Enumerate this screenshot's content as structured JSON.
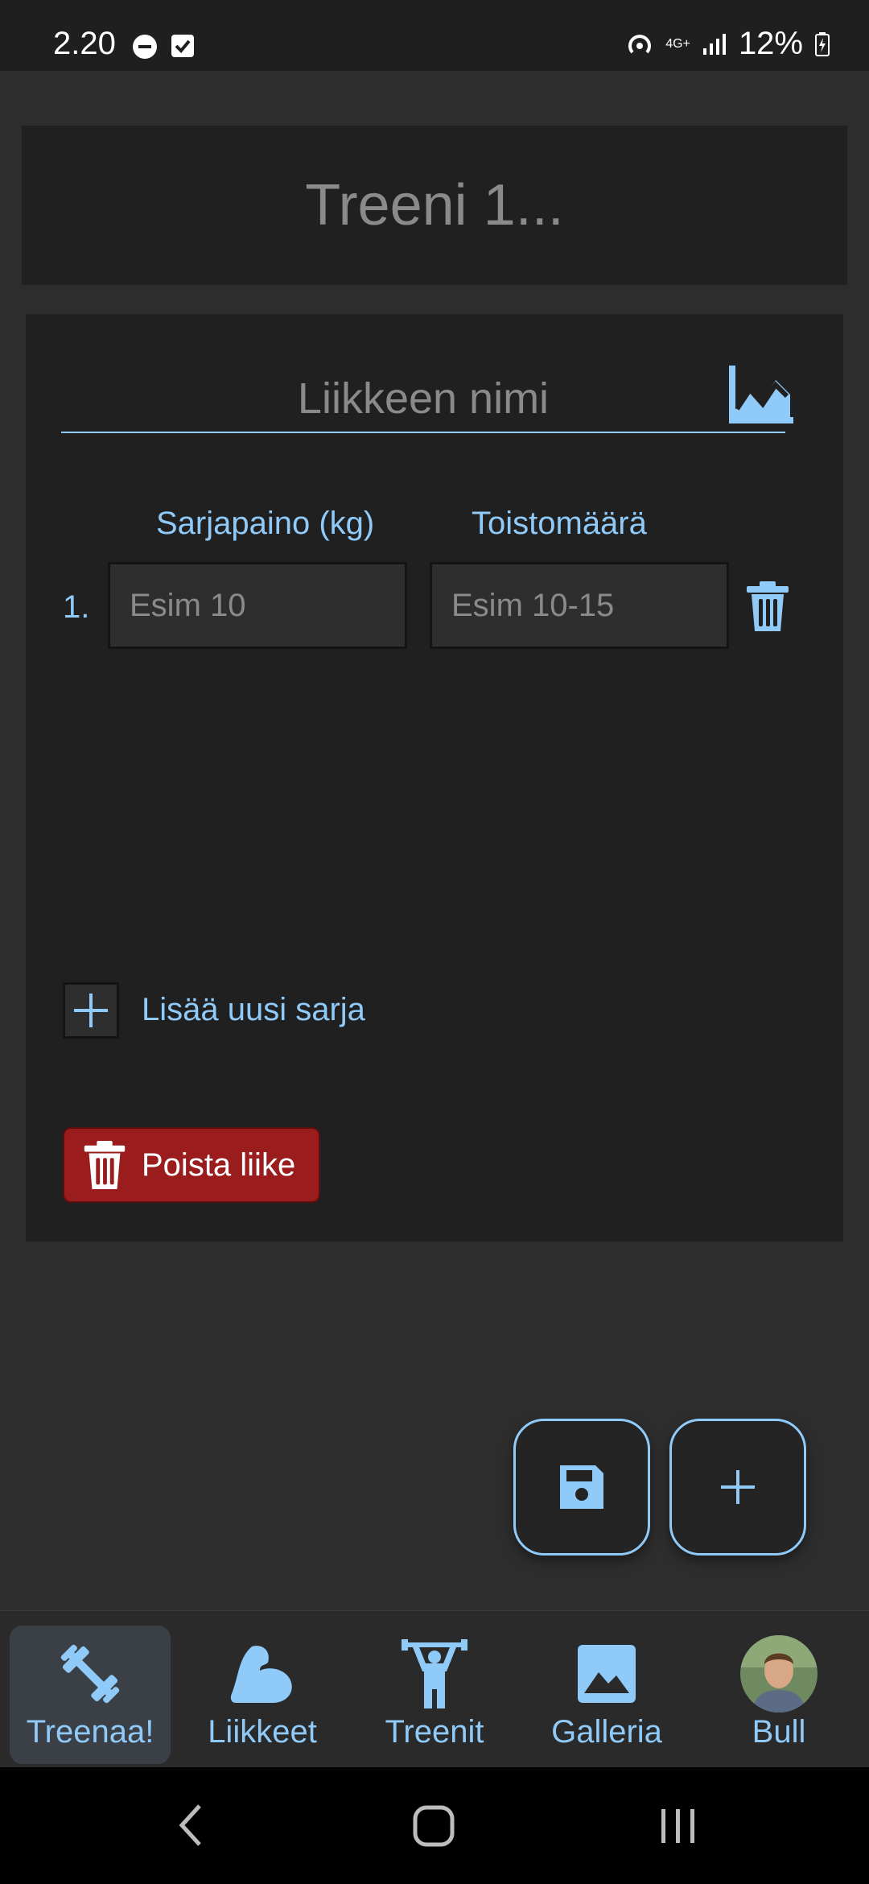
{
  "status_bar": {
    "time": "2.20",
    "network": "4G+",
    "battery": "12%"
  },
  "title": {
    "placeholder": "Treeni 1..."
  },
  "exercise": {
    "name_placeholder": "Liikkeen nimi",
    "weight_header": "Sarjapaino (kg)",
    "reps_header": "Toistomäärä",
    "sets": [
      {
        "number": "1.",
        "weight_placeholder": "Esim 10",
        "reps_placeholder": "Esim 10-15"
      }
    ],
    "add_set_label": "Lisää uusi sarja",
    "delete_label": "Poista liike"
  },
  "nav": {
    "items": [
      {
        "label": "Treenaa!",
        "icon": "dumbbell-icon",
        "active": true
      },
      {
        "label": "Liikkeet",
        "icon": "bicep-icon"
      },
      {
        "label": "Treenit",
        "icon": "weightlifter-icon"
      },
      {
        "label": "Galleria",
        "icon": "image-icon"
      },
      {
        "label": "Bull",
        "icon": "avatar"
      }
    ]
  },
  "colors": {
    "accent": "#90caf9",
    "danger": "#9b1c1c",
    "background": "#2d2d2d",
    "card": "#202020"
  }
}
